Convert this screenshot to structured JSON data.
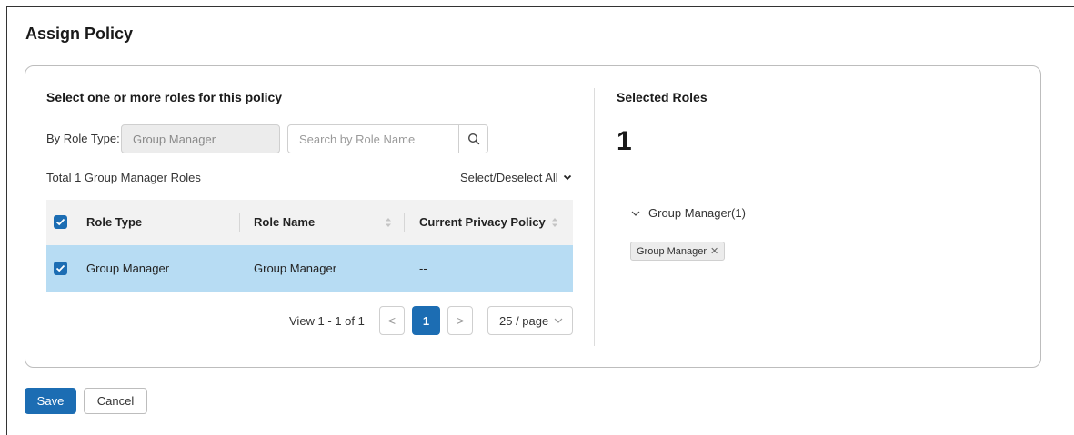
{
  "page": {
    "title": "Assign Policy"
  },
  "left_panel": {
    "section_title": "Select one or more roles for this policy",
    "role_type_label": "By Role Type:",
    "role_type_value": "Group Manager",
    "search_placeholder": "Search by Role Name",
    "total_label": "Total 1 Group Manager Roles",
    "select_all_label": "Select/Deselect All"
  },
  "table": {
    "columns": [
      "Role Type",
      "Role Name",
      "Current Privacy Policy"
    ],
    "rows": [
      {
        "role_type": "Group Manager",
        "role_name": "Group Manager",
        "privacy_policy": "--",
        "selected": true
      }
    ],
    "header_checked": true
  },
  "pagination": {
    "view_label": "View 1 - 1 of 1",
    "prev_symbol": "<",
    "next_symbol": ">",
    "current_page": "1",
    "page_size": "25 / page"
  },
  "right_panel": {
    "title": "Selected Roles",
    "count": "1",
    "group_label": "Group Manager(1)",
    "tags": [
      "Group Manager"
    ]
  },
  "footer": {
    "save_label": "Save",
    "cancel_label": "Cancel"
  },
  "colors": {
    "accent": "#1c6db3",
    "selected_row": "#b7dcf3",
    "header_bg": "#f2f2f2"
  }
}
